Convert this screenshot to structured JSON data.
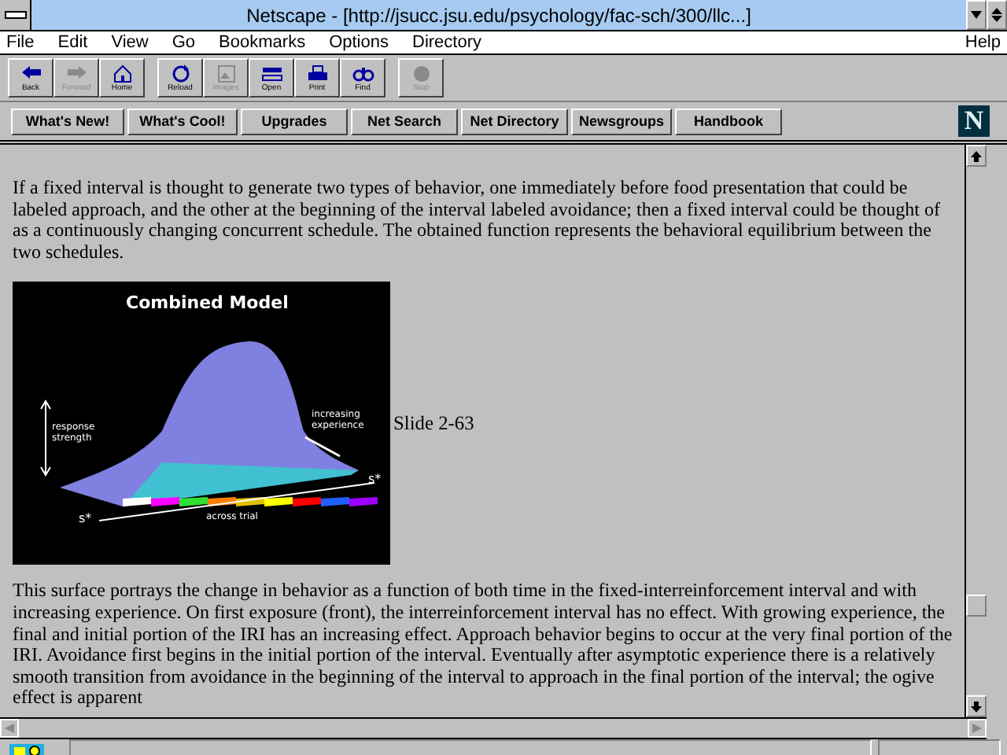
{
  "window": {
    "title": "Netscape - [http://jsucc.jsu.edu/psychology/fac-sch/300/llc...]"
  },
  "menu": [
    {
      "label": "File"
    },
    {
      "label": "Edit"
    },
    {
      "label": "View"
    },
    {
      "label": "Go"
    },
    {
      "label": "Bookmarks"
    },
    {
      "label": "Options"
    },
    {
      "label": "Directory"
    },
    {
      "label": "Help"
    }
  ],
  "toolbar": [
    [
      {
        "label": "Back",
        "kind": "back",
        "disabled": false
      },
      {
        "label": "Forward",
        "kind": "forward",
        "disabled": true
      },
      {
        "label": "Home",
        "kind": "home",
        "disabled": false
      }
    ],
    [
      {
        "label": "Reload",
        "kind": "reload",
        "disabled": false
      },
      {
        "label": "Images",
        "kind": "images",
        "disabled": true
      },
      {
        "label": "Open",
        "kind": "open",
        "disabled": false
      },
      {
        "label": "Print",
        "kind": "print",
        "disabled": false
      },
      {
        "label": "Find",
        "kind": "find",
        "disabled": false
      }
    ],
    [
      {
        "label": "Stop",
        "kind": "stop",
        "disabled": true
      }
    ]
  ],
  "directory_buttons": [
    "What's New!",
    "What's Cool!",
    "Upgrades",
    "Net Search",
    "Net Directory",
    "Newsgroups",
    "Handbook"
  ],
  "logo": {
    "letter": "N"
  },
  "content": {
    "paragraph_1": "If a fixed interval is thought to generate two types of behavior, one immediately before food presentation that could be labeled approach, and the other at the beginning of the interval labeled avoidance; then a fixed interval could be thought of as a continuously changing concurrent schedule. The obtained function represents the behavioral equilibrium between the two schedules.",
    "figure": {
      "title": "Combined Model",
      "y_label": "response strength",
      "depth_label": "increasing experience",
      "axis_right": "s*",
      "axis_left": "s*",
      "x_label": "across trial"
    },
    "caption": "Slide 2-63",
    "paragraph_2": "This surface portrays the change in behavior as a function of both time in the fixed-interreinforcement interval and with increasing experience. On first exposure (front), the interreinforcement interval has no effect. With growing experience, the final and initial portion of the IRI has an increasing effect. Approach behavior begins to occur at the very final portion of the IRI. Avoidance first begins in the initial portion of the interval. Eventually after asymptotic experience there is a relatively smooth transition from avoidance in the beginning of the interval to approach in the final portion of the interval; the ogive effect is apparent"
  }
}
